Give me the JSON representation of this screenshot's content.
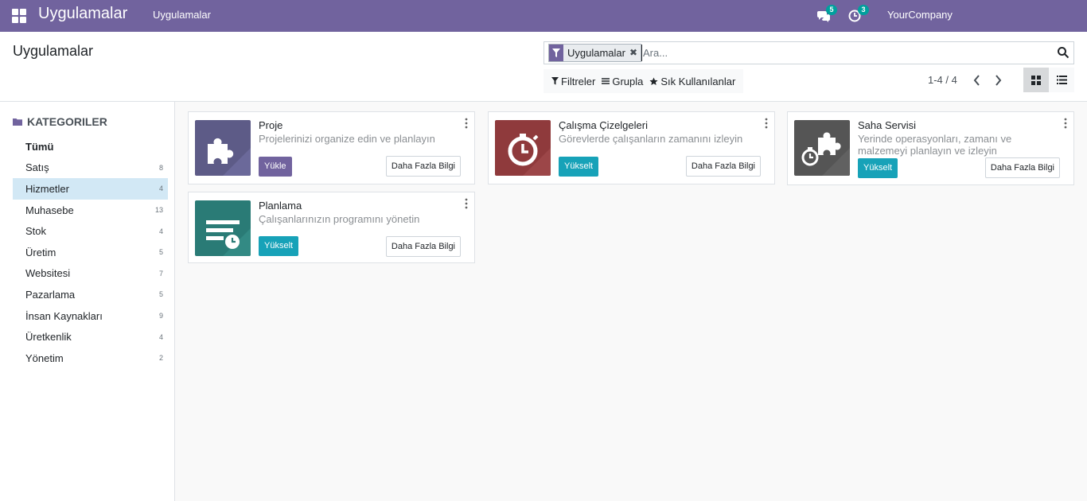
{
  "navbar": {
    "brand": "Uygulamalar",
    "menu_item": "Uygulamalar",
    "messages_badge": "5",
    "activities_badge": "3",
    "company": "YourCompany"
  },
  "control_panel": {
    "title": "Uygulamalar",
    "facet_label": "Uygulamalar",
    "facet_remove": "✖",
    "search_placeholder": "Ara...",
    "filters_label": "Filtreler",
    "group_label": "Grupla",
    "favorites_label": "Sık Kullanılanlar",
    "pager": "1-4 / 4"
  },
  "sidebar": {
    "header": "KATEGORILER",
    "items": [
      {
        "label": "Tümü",
        "count": ""
      },
      {
        "label": "Satış",
        "count": "8"
      },
      {
        "label": "Hizmetler",
        "count": "4"
      },
      {
        "label": "Muhasebe",
        "count": "13"
      },
      {
        "label": "Stok",
        "count": "4"
      },
      {
        "label": "Üretim",
        "count": "5"
      },
      {
        "label": "Websitesi",
        "count": "7"
      },
      {
        "label": "Pazarlama",
        "count": "5"
      },
      {
        "label": "İnsan Kaynakları",
        "count": "9"
      },
      {
        "label": "Üretkenlik",
        "count": "4"
      },
      {
        "label": "Yönetim",
        "count": "2"
      }
    ]
  },
  "apps": [
    {
      "name": "Proje",
      "summary": "Projelerinizi organize edin ve planlayın",
      "action": "Yükle",
      "more": "Daha Fazla Bilgi",
      "icon": "puzzle-icon",
      "icon_color": "#5d5b87",
      "action_color": "#71639e"
    },
    {
      "name": "Çalışma Çizelgeleri",
      "summary": "Görevlerde çalışanların zamanını izleyin",
      "action": "Yükselt",
      "more": "Daha Fazla Bilgi",
      "icon": "stopwatch-icon",
      "icon_color": "#8f3a3c",
      "action_color": "#17a2b8"
    },
    {
      "name": "Saha Servisi",
      "summary": "Yerinde operasyonları, zamanı ve malzemeyi planlayın ve izleyin",
      "action": "Yükselt",
      "more": "Daha Fazla Bilgi",
      "icon": "puzzle-stopwatch-icon",
      "icon_color": "#555555",
      "action_color": "#17a2b8"
    },
    {
      "name": "Planlama",
      "summary": "Çalışanlarınızın programını yönetin",
      "action": "Yükselt",
      "more": "Daha Fazla Bilgi",
      "icon": "schedule-icon",
      "icon_color": "#2a7b76",
      "action_color": "#17a2b8"
    }
  ]
}
